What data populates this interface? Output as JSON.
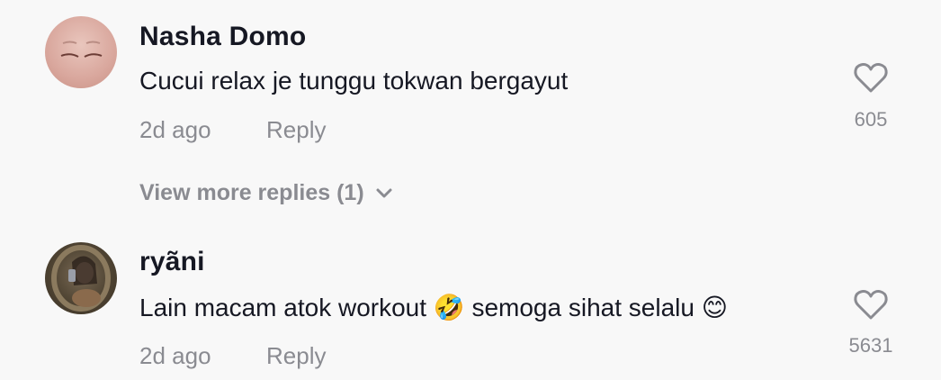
{
  "comments": [
    {
      "username": "Nasha Domo",
      "text": "Cucui relax je tunggu tokwan bergayut",
      "time": "2d ago",
      "reply_label": "Reply",
      "likes": "605",
      "view_more": "View more replies (1)"
    },
    {
      "username": "ryãni",
      "text_part1": "Lain macam atok workout ",
      "emoji1": "🤣",
      "text_part2": " semoga sihat selalu ",
      "emoji2": "😊",
      "time": "2d ago",
      "reply_label": "Reply",
      "likes": "5631"
    }
  ],
  "icons": {
    "like": "heart-outline-icon",
    "expand": "chevron-down-icon"
  }
}
